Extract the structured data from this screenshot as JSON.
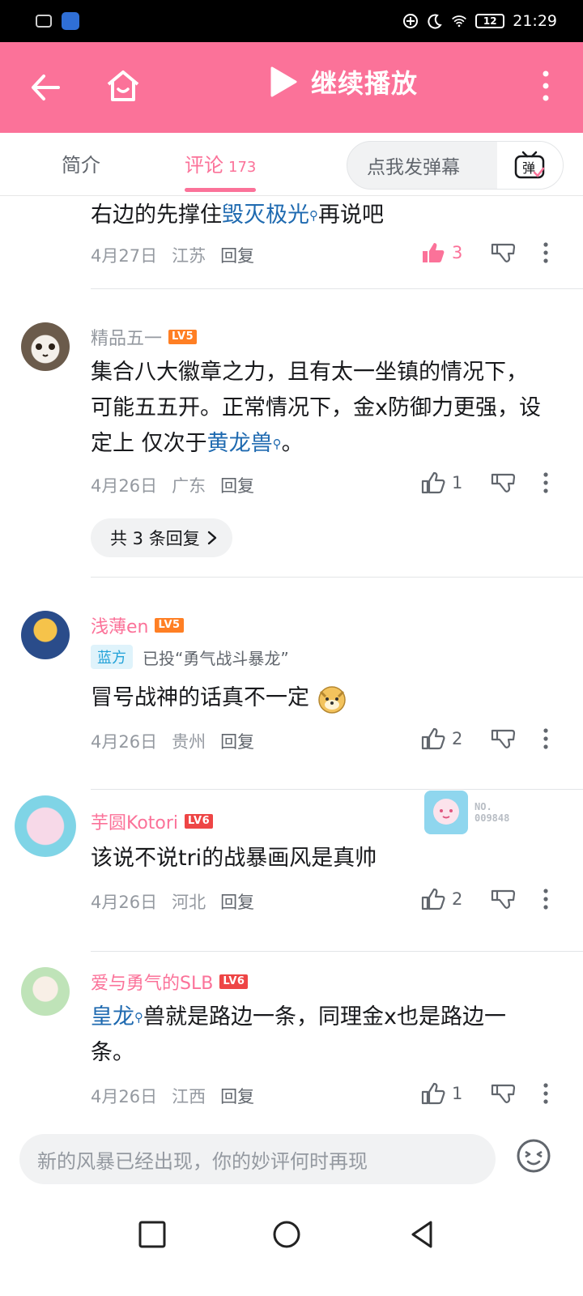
{
  "status_bar": {
    "time": "21:29",
    "battery": "12"
  },
  "top_bar": {
    "play_label": "继续播放"
  },
  "tabs": {
    "intro": "简介",
    "comments": "评论",
    "comment_count": "173",
    "danmaku_placeholder": "点我发弹幕",
    "danmaku_icon_label": "弹"
  },
  "comments": [
    {
      "text_parts": [
        "右边的先撑住",
        "毁灭极光",
        "再说吧"
      ],
      "date": "4月27日",
      "location": "江苏",
      "reply": "回复",
      "likes": "3",
      "liked": true
    },
    {
      "username": "精品五一",
      "level": "LV5",
      "text_parts": [
        "集合八大徽章之力，且有太一坐镇的情况下，可能五五开。正常情况下，金x防御力更强，设定上 仅次于",
        "黄龙兽",
        "。"
      ],
      "date": "4月26日",
      "location": "广东",
      "reply": "回复",
      "likes": "1",
      "replies_pill": "共 3 条回复"
    },
    {
      "username": "浅薄en",
      "level": "LV5",
      "vote_tag": "蓝方",
      "vote_text": "已投“勇气战斗暴龙”",
      "text": "冒号战神的话真不一定",
      "date": "4月26日",
      "location": "贵州",
      "reply": "回复",
      "likes": "2"
    },
    {
      "username": "芋圆Kotori",
      "level": "LV6",
      "badge_no": "NO.",
      "badge_num": "009848",
      "text": "该说不说tri的战暴画风是真帅",
      "date": "4月26日",
      "location": "河北",
      "reply": "回复",
      "likes": "2"
    },
    {
      "username": "爱与勇气的SLB",
      "level": "LV6",
      "text_parts": [
        "皇龙",
        "兽就是路边一条，同理金x也是路边一条。"
      ],
      "date": "4月26日",
      "location": "江西",
      "reply": "回复",
      "likes": "1"
    }
  ],
  "input": {
    "placeholder": "新的风暴已经出现，你的妙评何时再现"
  },
  "colors": {
    "accent": "#fb7299",
    "link": "#1f6ab0",
    "meta": "#9499a0"
  }
}
